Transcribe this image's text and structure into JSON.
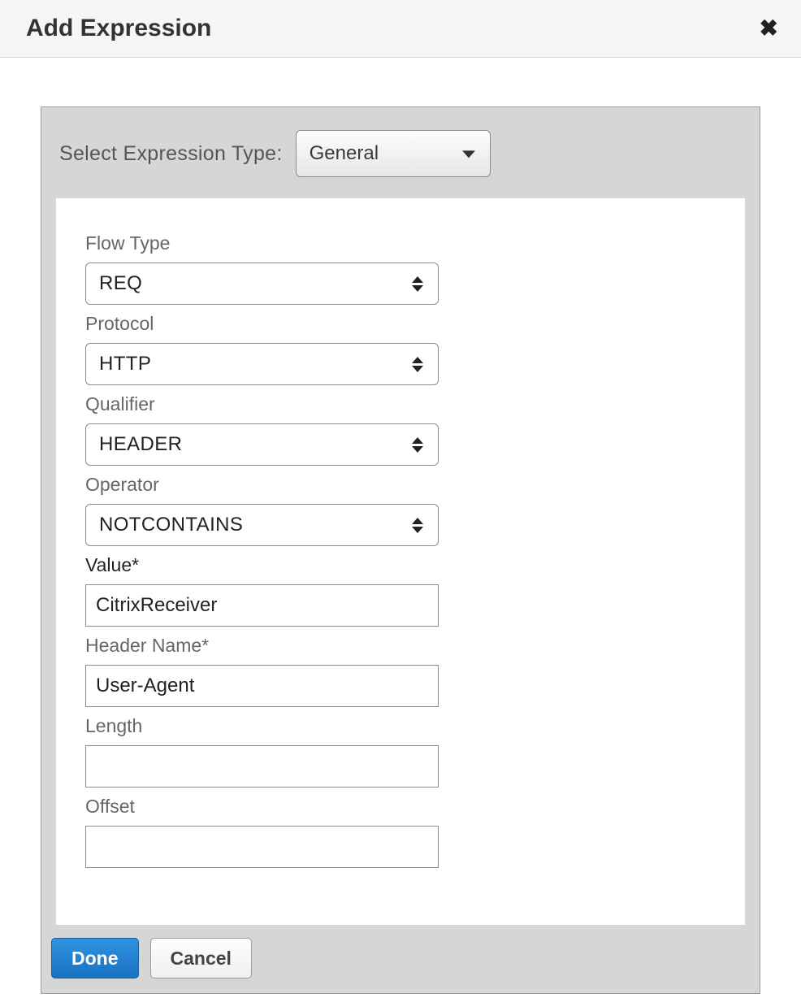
{
  "dialog": {
    "title": "Add Expression"
  },
  "typeRow": {
    "label": "Select Expression Type:",
    "value": "General"
  },
  "fields": {
    "flowType": {
      "label": "Flow Type",
      "value": "REQ"
    },
    "protocol": {
      "label": "Protocol",
      "value": "HTTP"
    },
    "qualifier": {
      "label": "Qualifier",
      "value": "HEADER"
    },
    "operator": {
      "label": "Operator",
      "value": "NOTCONTAINS"
    },
    "value": {
      "label": "Value*",
      "value": "CitrixReceiver"
    },
    "headerName": {
      "label": "Header Name*",
      "value": "User-Agent"
    },
    "length": {
      "label": "Length",
      "value": ""
    },
    "offset": {
      "label": "Offset",
      "value": ""
    }
  },
  "buttons": {
    "done": "Done",
    "cancel": "Cancel"
  }
}
